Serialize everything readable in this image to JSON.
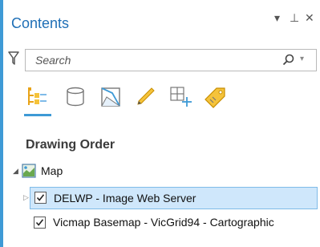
{
  "pane": {
    "title": "Contents",
    "header_buttons": [
      "▾",
      "⊥",
      "✕"
    ]
  },
  "search": {
    "placeholder": "Search"
  },
  "toolbar": {
    "tools": [
      "list-by-drawing-order-icon",
      "list-by-data-source-icon",
      "list-by-selection-icon",
      "list-by-editing-icon",
      "list-by-snapping-icon",
      "list-by-labeling-icon"
    ],
    "active_tool": "list-by-drawing-order-icon"
  },
  "section": {
    "title": "Drawing Order"
  },
  "tree": {
    "map": {
      "label": "Map",
      "expanded": true
    },
    "layers": [
      {
        "label": "DELWP - Image Web Server",
        "checked": true,
        "selected": true
      },
      {
        "label": "Vicmap Basemap - VicGrid94 - Cartographic",
        "checked": true,
        "selected": false
      }
    ]
  },
  "colors": {
    "accent": "#3e9ad6",
    "title": "#1f6fb6",
    "selection_bg": "#cfe7fb",
    "selection_border": "#7fbbe8"
  }
}
